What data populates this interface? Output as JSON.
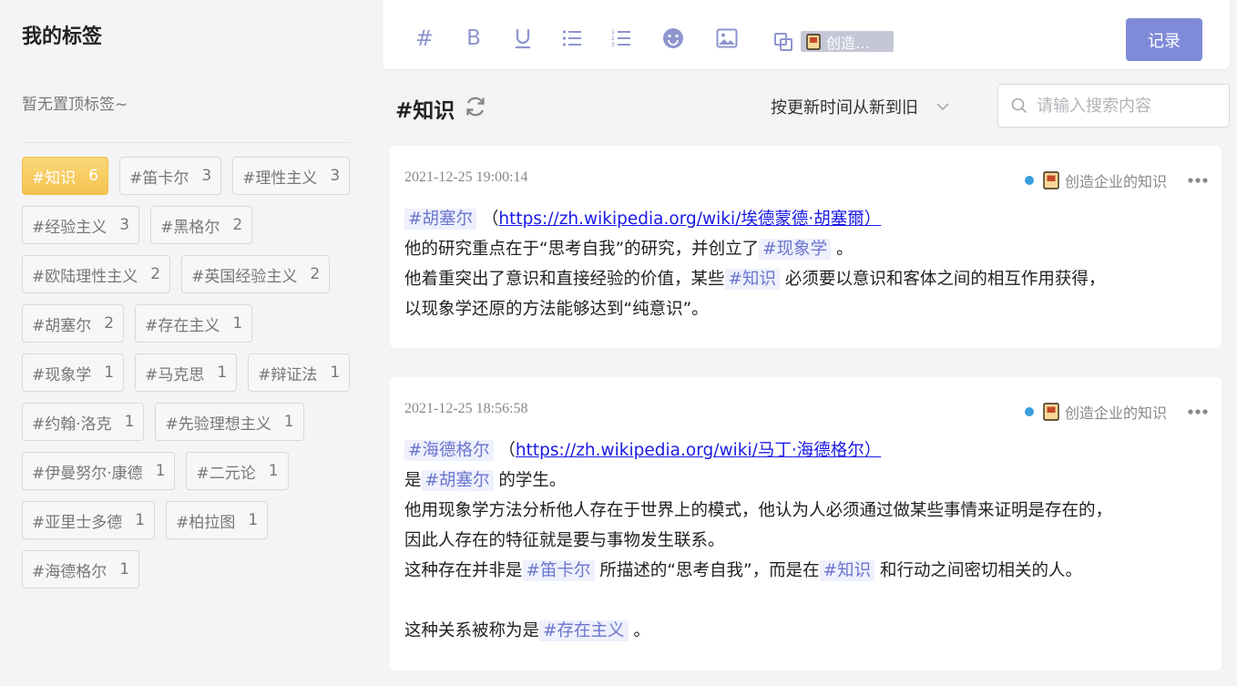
{
  "sidebar": {
    "title": "我的标签",
    "empty_pinned": "暂无置顶标签~",
    "tags": [
      {
        "name": "#知识",
        "count": "6",
        "active": true
      },
      {
        "name": "#笛卡尔",
        "count": "3"
      },
      {
        "name": "#理性主义",
        "count": "3"
      },
      {
        "name": "#经验主义",
        "count": "3"
      },
      {
        "name": "#黑格尔",
        "count": "2"
      },
      {
        "name": "#欧陆理性主义",
        "count": "2"
      },
      {
        "name": "#英国经验主义",
        "count": "2"
      },
      {
        "name": "#胡塞尔",
        "count": "2"
      },
      {
        "name": "#存在主义",
        "count": "1"
      },
      {
        "name": "#现象学",
        "count": "1"
      },
      {
        "name": "#马克思",
        "count": "1"
      },
      {
        "name": "#辩证法",
        "count": "1"
      },
      {
        "name": "#约翰·洛克",
        "count": "1"
      },
      {
        "name": "#先验理想主义",
        "count": "1"
      },
      {
        "name": "#伊曼努尔·康德",
        "count": "1"
      },
      {
        "name": "#二元论",
        "count": "1"
      },
      {
        "name": "#亚里士多德",
        "count": "1"
      },
      {
        "name": "#柏拉图",
        "count": "1"
      },
      {
        "name": "#海德格尔",
        "count": "1"
      }
    ]
  },
  "editor": {
    "tools": [
      {
        "icon": "hash-icon",
        "glyph": "#"
      },
      {
        "icon": "bold-icon",
        "glyph": "B"
      },
      {
        "icon": "underline-icon",
        "glyph": "U"
      },
      {
        "icon": "bullet-list-icon",
        "glyph": ""
      },
      {
        "icon": "numbered-list-icon",
        "glyph": ""
      },
      {
        "icon": "emoji-icon",
        "glyph": ""
      },
      {
        "icon": "image-icon",
        "glyph": ""
      },
      {
        "icon": "book-link-icon",
        "glyph": ""
      }
    ],
    "book_chip": "创造…",
    "record_label": "记录"
  },
  "header": {
    "title": "#知识",
    "sort_label": "按更新时间从新到旧",
    "search_placeholder": "请输入搜索内容"
  },
  "notes": [
    {
      "time": "2021-12-25 19:00:14",
      "book": "创造企业的知识",
      "lines": [
        [
          {
            "t": "tag",
            "v": "#胡塞尔"
          },
          {
            "t": "text",
            "v": " （"
          },
          {
            "t": "link",
            "v": "https://zh.wikipedia.org/wiki/埃德蒙德·胡塞爾）"
          }
        ],
        [
          {
            "t": "text",
            "v": "他的研究重点在于“思考自我”的研究，并创立了"
          },
          {
            "t": "tag",
            "v": "#现象学"
          },
          {
            "t": "text",
            "v": " 。"
          }
        ],
        [
          {
            "t": "text",
            "v": "他着重突出了意识和直接经验的价值，某些"
          },
          {
            "t": "tag",
            "v": "#知识"
          },
          {
            "t": "text",
            "v": " 必须要以意识和客体之间的相互作用获得，"
          }
        ],
        [
          {
            "t": "text",
            "v": "以现象学还原的方法能够达到“纯意识”。"
          }
        ]
      ]
    },
    {
      "time": "2021-12-25 18:56:58",
      "book": "创造企业的知识",
      "lines": [
        [
          {
            "t": "tag",
            "v": "#海德格尔"
          },
          {
            "t": "text",
            "v": " （"
          },
          {
            "t": "link",
            "v": "https://zh.wikipedia.org/wiki/马丁·海德格尔）"
          }
        ],
        [
          {
            "t": "text",
            "v": "是"
          },
          {
            "t": "tag",
            "v": "#胡塞尔"
          },
          {
            "t": "text",
            "v": " 的学生。"
          }
        ],
        [
          {
            "t": "text",
            "v": "他用现象学方法分析他人存在于世界上的模式，他认为人必须通过做某些事情来证明是存在的，"
          }
        ],
        [
          {
            "t": "text",
            "v": "因此人存在的特征就是要与事物发生联系。"
          }
        ],
        [
          {
            "t": "text",
            "v": "这种存在并非是"
          },
          {
            "t": "tag",
            "v": "#笛卡尔"
          },
          {
            "t": "text",
            "v": " 所描述的“思考自我”，而是在"
          },
          {
            "t": "tag",
            "v": "#知识"
          },
          {
            "t": "text",
            "v": " 和行动之间密切相关的人。"
          }
        ],
        [
          {
            "t": "text",
            "v": ""
          }
        ],
        [
          {
            "t": "text",
            "v": "这种关系被称为是"
          },
          {
            "t": "tag",
            "v": "#存在主义"
          },
          {
            "t": "text",
            "v": " 。"
          }
        ]
      ]
    }
  ]
}
